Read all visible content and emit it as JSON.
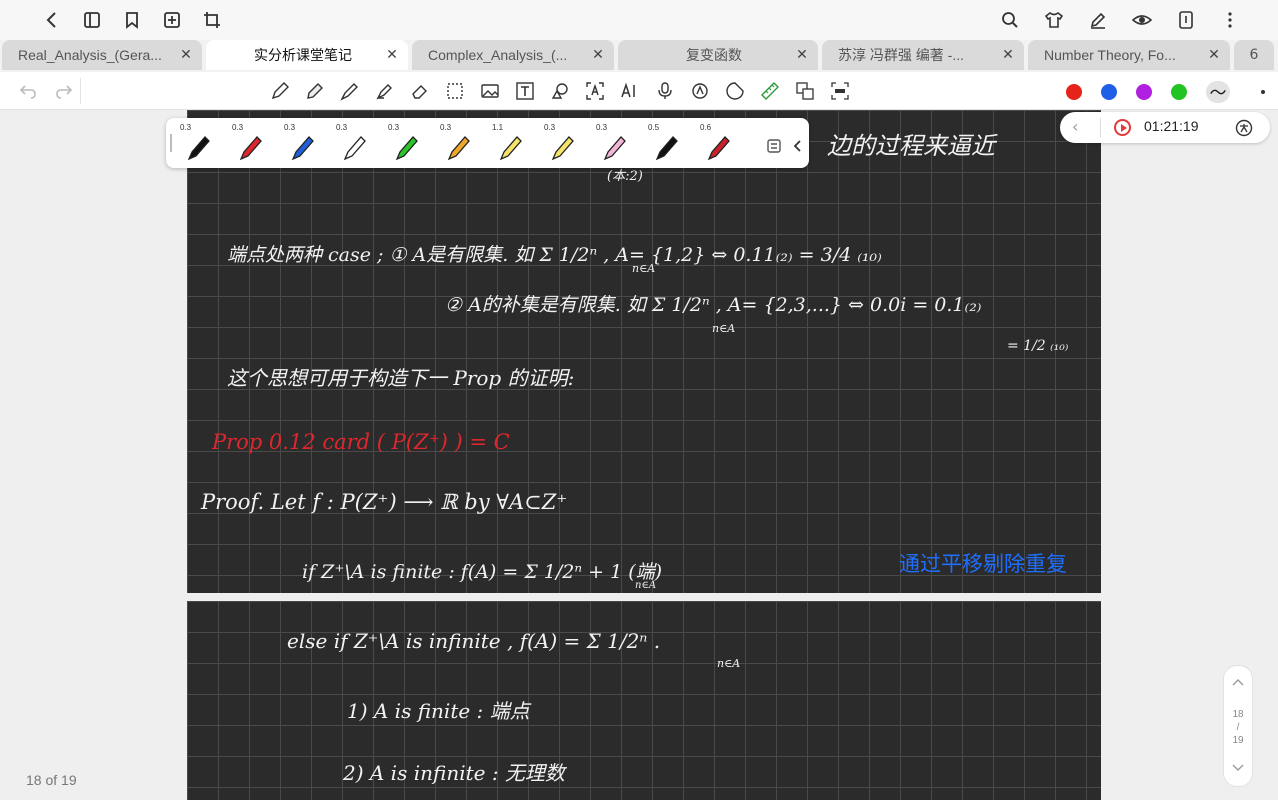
{
  "tabs": [
    {
      "label": "Real_Analysis_(Gera...",
      "close": "✕"
    },
    {
      "label": "实分析课堂笔记",
      "close": "✕",
      "active": true
    },
    {
      "label": "Complex_Analysis_(...",
      "close": "✕"
    },
    {
      "label": "复变函数",
      "close": "✕"
    },
    {
      "label": "苏淳 冯群强 编著 -...",
      "close": "✕"
    },
    {
      "label": "Number Theory, Fo...",
      "close": "✕"
    },
    {
      "label": "6"
    }
  ],
  "pen_palette": [
    {
      "size": "0.3",
      "color": "#111111"
    },
    {
      "size": "0.3",
      "color": "#e0262d"
    },
    {
      "size": "0.3",
      "color": "#1f5fd8"
    },
    {
      "size": "0.3",
      "color": "#ffffff"
    },
    {
      "size": "0.3",
      "color": "#2bc42b"
    },
    {
      "size": "0.3",
      "color": "#f1a72b"
    },
    {
      "size": "1.1",
      "color": "#f5e36a"
    },
    {
      "size": "0.3",
      "color": "#f5e36a"
    },
    {
      "size": "0.3",
      "color": "#f3b5d8"
    },
    {
      "size": "0.5",
      "color": "#111111"
    },
    {
      "size": "0.6",
      "color": "#c8232a"
    }
  ],
  "colors": [
    "#e5231b",
    "#1f5fe8",
    "#b020e0",
    "#22c322"
  ],
  "recording": {
    "time": "01:21:19"
  },
  "page_indicator": "18 of 19",
  "scroller": {
    "current": "18",
    "slash": "/",
    "total": "19"
  },
  "notes": {
    "top_text": "边的过程来逼近",
    "top_sub": "(本:2)",
    "line1": "端点处两种 case ; ① A是有限集. 如 Σ 1/2ⁿ , A= {1,2}   ⇔  0.11₍₂₎ = 3/4 ₍₁₀₎",
    "line1_sub": "n∈A",
    "line2": "② A的补集是有限集. 如 Σ 1/2ⁿ , A= {2,3,...} ⇔ 0.0i = 0.1₍₂₎",
    "line2_sub": "n∈A",
    "line2_tail": "= 1/2 ₍₁₀₎",
    "line3": "这个思想可用于构造下一 Prop 的证明:",
    "prop": "Prop  0.12     card ( P(Z⁺) ) = C",
    "proof": "Proof.   Let    f : P(Z⁺) ⟶ ℝ    by     ∀A⊂Z⁺",
    "if_line": "if   Z⁺\\A  is  finite :  f(A) = Σ 1/2ⁿ + 1      (端)",
    "if_sub": "n∈A",
    "blue_note": "通过平移剔除重复",
    "else_line": "else if  Z⁺\\A  is  infinite ,   f(A) = Σ 1/2ⁿ .",
    "else_sub": "n∈A",
    "case1": "1) A  is   finite  :   端点",
    "case2": "2) A  is  infinite  :  无理数"
  }
}
